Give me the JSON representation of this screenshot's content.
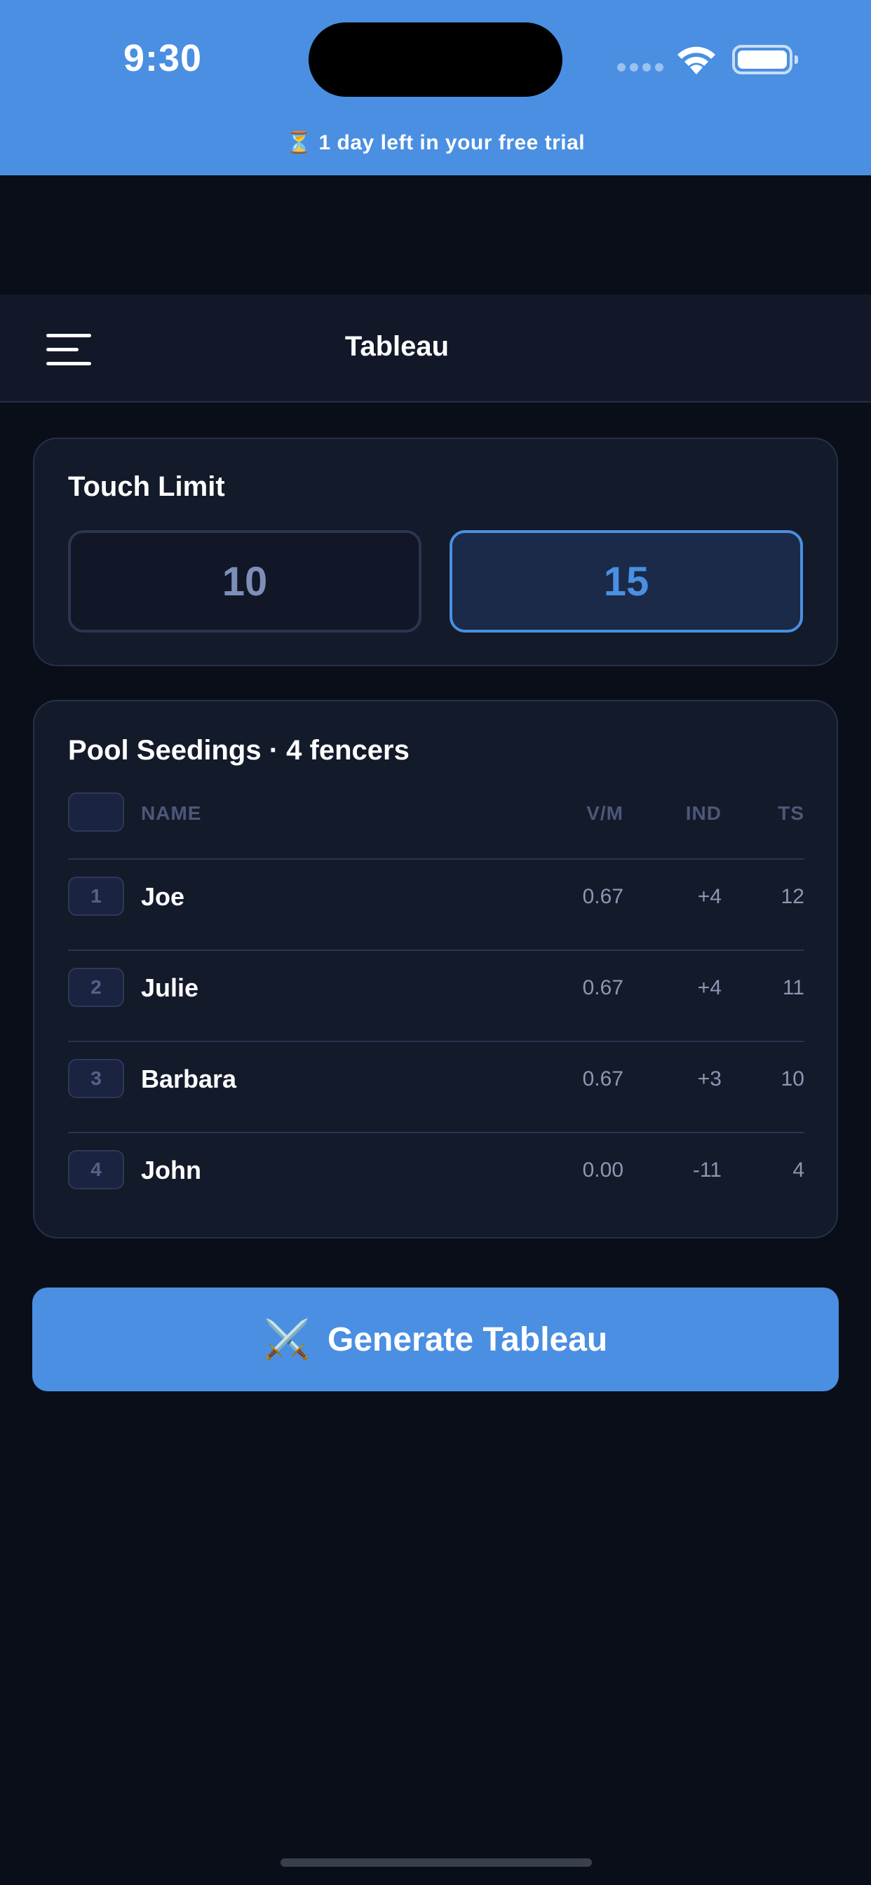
{
  "status_bar": {
    "time": "9:30"
  },
  "trial_banner": {
    "text": "⏳ 1 day left in your free trial"
  },
  "nav": {
    "title": "Tableau"
  },
  "touch_limit": {
    "title": "Touch Limit",
    "options": [
      "10",
      "15"
    ],
    "selected": "15"
  },
  "pool": {
    "title": "Pool Seedings · 4 fencers",
    "columns": {
      "name": "NAME",
      "vm": "V/M",
      "ind": "IND",
      "ts": "TS"
    },
    "rows": [
      {
        "seed": "1",
        "name": "Joe",
        "vm": "0.67",
        "ind": "+4",
        "ts": "12"
      },
      {
        "seed": "2",
        "name": "Julie",
        "vm": "0.67",
        "ind": "+4",
        "ts": "11"
      },
      {
        "seed": "3",
        "name": "Barbara",
        "vm": "0.67",
        "ind": "+3",
        "ts": "10"
      },
      {
        "seed": "4",
        "name": "John",
        "vm": "0.00",
        "ind": "-11",
        "ts": "4"
      }
    ]
  },
  "generate": {
    "icon": "⚔️",
    "label": "Generate Tableau"
  },
  "colors": {
    "accent": "#4a8fe2",
    "background": "#0a0e19",
    "card": "#131a2a"
  }
}
